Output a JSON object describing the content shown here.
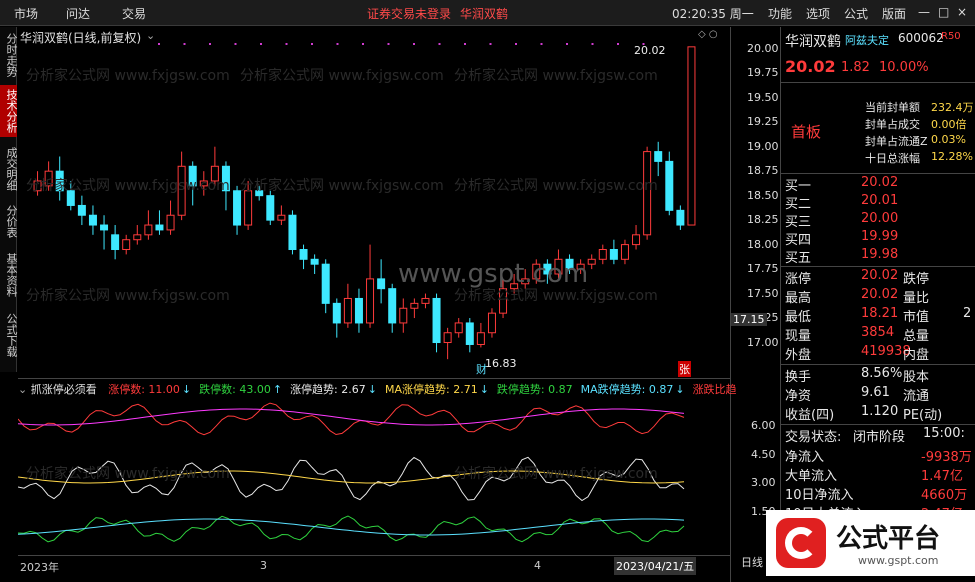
{
  "menu_left": [
    "市场",
    "问达",
    "交易"
  ],
  "notice": "证券交易未登录",
  "stock_header": "华润双鹤",
  "clock": "02:20:35 周一",
  "menu_right": [
    "功能",
    "选项",
    "公式",
    "版面"
  ],
  "window_controls": [
    "—",
    "□",
    "×"
  ],
  "vtabs": [
    "分时走势",
    "技术分析",
    "成交明细",
    "分价表",
    "基本资料",
    "公式下载"
  ],
  "chart_title": "华润双鹤(日线,前复权)",
  "price_labels": [
    "20.00",
    "19.75",
    "19.50",
    "19.25",
    "19.00",
    "18.75",
    "18.50",
    "18.25",
    "18.00",
    "17.75",
    "17.50",
    "17.25",
    "17.00"
  ],
  "cursor_price": "17.15",
  "high_mark": "20.02",
  "low_mark": "16.83",
  "mark_cai": "财",
  "mark_zhang": "张",
  "indicator": {
    "name": "抓涨停必须看",
    "items": [
      {
        "label": "涨停数: 11.00",
        "arrow": "↓"
      },
      {
        "label": "跌停数: 43.00",
        "arrow": "↑"
      },
      {
        "label": "涨停趋势: 2.67",
        "arrow": "↓"
      },
      {
        "label": "MA涨停趋势: 2.71",
        "arrow": "↓"
      },
      {
        "label": "跌停趋势: 0.87",
        "arrow": ""
      },
      {
        "label": "MA跌停趋势: 0.87",
        "arrow": "↓"
      },
      {
        "label": "涨跌比趋",
        "arrow": ""
      }
    ]
  },
  "ind_axis": [
    "6.00",
    "4.50",
    "3.00",
    "1.50"
  ],
  "bottom_labels": [
    "2023年",
    "3",
    "4",
    "2023/04/21/五"
  ],
  "axis_tab": "日线",
  "panel": {
    "name": "华润双鹤",
    "tag": "阿兹夫定",
    "code": "600062",
    "badge": "R50",
    "price": "20.02",
    "change": "1.82",
    "pct": "10.00%",
    "board": "首板",
    "seal": [
      {
        "k": "当前封单额",
        "v": "232.4万"
      },
      {
        "k": "封单占成交",
        "v": "0.00倍"
      },
      {
        "k": "封单占流通Z",
        "v": "0.03%"
      },
      {
        "k": "十日总涨幅",
        "v": "12.28%"
      }
    ],
    "bids": [
      {
        "k": "买一",
        "v": "20.02"
      },
      {
        "k": "买二",
        "v": "20.01"
      },
      {
        "k": "买三",
        "v": "20.00"
      },
      {
        "k": "买四",
        "v": "19.99"
      },
      {
        "k": "买五",
        "v": "19.98"
      }
    ],
    "quote": [
      {
        "k": "涨停",
        "v": "20.02",
        "k2": "跌停",
        "v2": ""
      },
      {
        "k": "最高",
        "v": "20.02",
        "k2": "量比",
        "v2": ""
      },
      {
        "k": "最低",
        "v": "18.21",
        "k2": "市值",
        "v2": "2"
      },
      {
        "k": "现量",
        "v": "3854",
        "k2": "总量",
        "v2": ""
      },
      {
        "k": "外盘",
        "v": "419938",
        "k2": "内盘",
        "v2": ""
      }
    ],
    "fin": [
      {
        "k": "换手",
        "v": "8.56%",
        "k2": "股本"
      },
      {
        "k": "净资",
        "v": "9.61",
        "k2": "流通"
      },
      {
        "k": "收益(四)",
        "v": "1.120",
        "k2": "PE(动)"
      }
    ],
    "status_label": "交易状态:",
    "status": "闭市阶段",
    "status_time": "15:00:",
    "flows": [
      {
        "k": "净流入",
        "v": "-9938万"
      },
      {
        "k": "大单流入",
        "v": "1.47亿"
      },
      {
        "k": "10日净流入",
        "v": "4660万"
      },
      {
        "k": "10日大单流入",
        "v": "2.47亿"
      }
    ]
  },
  "logo_text": "公式平台",
  "logo_url": "www.gspt.com",
  "watermark": "分析家公式网 www.fxjgsw.com",
  "center_watermark": "www.gspt.com",
  "chart_data": {
    "type": "candlestick",
    "y_range": [
      16.75,
      20.1
    ],
    "candles": [
      [
        18.55,
        18.65,
        18.5,
        18.75
      ],
      [
        18.6,
        18.75,
        18.55,
        18.85
      ],
      [
        18.75,
        18.55,
        18.45,
        18.9
      ],
      [
        18.55,
        18.4,
        18.35,
        18.65
      ],
      [
        18.4,
        18.3,
        18.2,
        18.5
      ],
      [
        18.3,
        18.2,
        18.1,
        18.4
      ],
      [
        18.2,
        18.15,
        17.95,
        18.3
      ],
      [
        18.1,
        17.95,
        17.85,
        18.2
      ],
      [
        17.95,
        18.05,
        17.9,
        18.1
      ],
      [
        18.05,
        18.1,
        18.0,
        18.2
      ],
      [
        18.1,
        18.2,
        18.05,
        18.35
      ],
      [
        18.2,
        18.15,
        18.1,
        18.35
      ],
      [
        18.15,
        18.3,
        18.1,
        18.45
      ],
      [
        18.3,
        18.8,
        18.25,
        18.95
      ],
      [
        18.8,
        18.6,
        18.4,
        18.85
      ],
      [
        18.6,
        18.65,
        18.5,
        18.75
      ],
      [
        18.65,
        18.8,
        18.6,
        19.0
      ],
      [
        18.8,
        18.55,
        18.35,
        18.85
      ],
      [
        18.55,
        18.2,
        18.1,
        18.6
      ],
      [
        18.2,
        18.55,
        18.15,
        18.65
      ],
      [
        18.55,
        18.5,
        18.45,
        18.6
      ],
      [
        18.5,
        18.25,
        18.2,
        18.55
      ],
      [
        18.25,
        18.3,
        18.2,
        18.4
      ],
      [
        18.3,
        17.95,
        17.9,
        18.35
      ],
      [
        17.95,
        17.85,
        17.75,
        18.0
      ],
      [
        17.85,
        17.8,
        17.7,
        17.9
      ],
      [
        17.8,
        17.4,
        17.3,
        17.85
      ],
      [
        17.4,
        17.2,
        17.05,
        17.45
      ],
      [
        17.2,
        17.45,
        17.15,
        17.6
      ],
      [
        17.45,
        17.2,
        17.1,
        17.55
      ],
      [
        17.2,
        17.65,
        17.15,
        18.0
      ],
      [
        17.65,
        17.55,
        17.4,
        17.85
      ],
      [
        17.55,
        17.2,
        17.1,
        17.6
      ],
      [
        17.2,
        17.35,
        17.1,
        17.45
      ],
      [
        17.35,
        17.4,
        17.25,
        17.45
      ],
      [
        17.4,
        17.45,
        17.35,
        17.5
      ],
      [
        17.45,
        17.0,
        16.9,
        17.5
      ],
      [
        17.0,
        17.1,
        16.83,
        17.15
      ],
      [
        17.1,
        17.2,
        17.05,
        17.25
      ],
      [
        17.2,
        16.98,
        16.9,
        17.25
      ],
      [
        16.98,
        17.1,
        16.95,
        17.2
      ],
      [
        17.1,
        17.3,
        17.05,
        17.35
      ],
      [
        17.3,
        17.55,
        17.25,
        17.65
      ],
      [
        17.55,
        17.6,
        17.5,
        17.7
      ],
      [
        17.6,
        17.65,
        17.55,
        17.75
      ],
      [
        17.65,
        17.8,
        17.6,
        17.85
      ],
      [
        17.8,
        17.7,
        17.6,
        17.85
      ],
      [
        17.7,
        17.85,
        17.65,
        17.95
      ],
      [
        17.85,
        17.75,
        17.7,
        17.9
      ],
      [
        17.75,
        17.8,
        17.7,
        17.85
      ],
      [
        17.8,
        17.85,
        17.75,
        17.9
      ],
      [
        17.85,
        17.95,
        17.8,
        18.0
      ],
      [
        17.95,
        17.85,
        17.8,
        18.05
      ],
      [
        17.85,
        18.0,
        17.8,
        18.05
      ],
      [
        18.0,
        18.1,
        17.95,
        18.2
      ],
      [
        18.1,
        18.95,
        18.05,
        19.0
      ],
      [
        18.95,
        18.85,
        18.7,
        19.05
      ],
      [
        18.85,
        18.35,
        18.3,
        18.95
      ],
      [
        18.35,
        18.2,
        18.15,
        18.4
      ],
      [
        18.2,
        20.02,
        18.21,
        20.02
      ]
    ]
  }
}
